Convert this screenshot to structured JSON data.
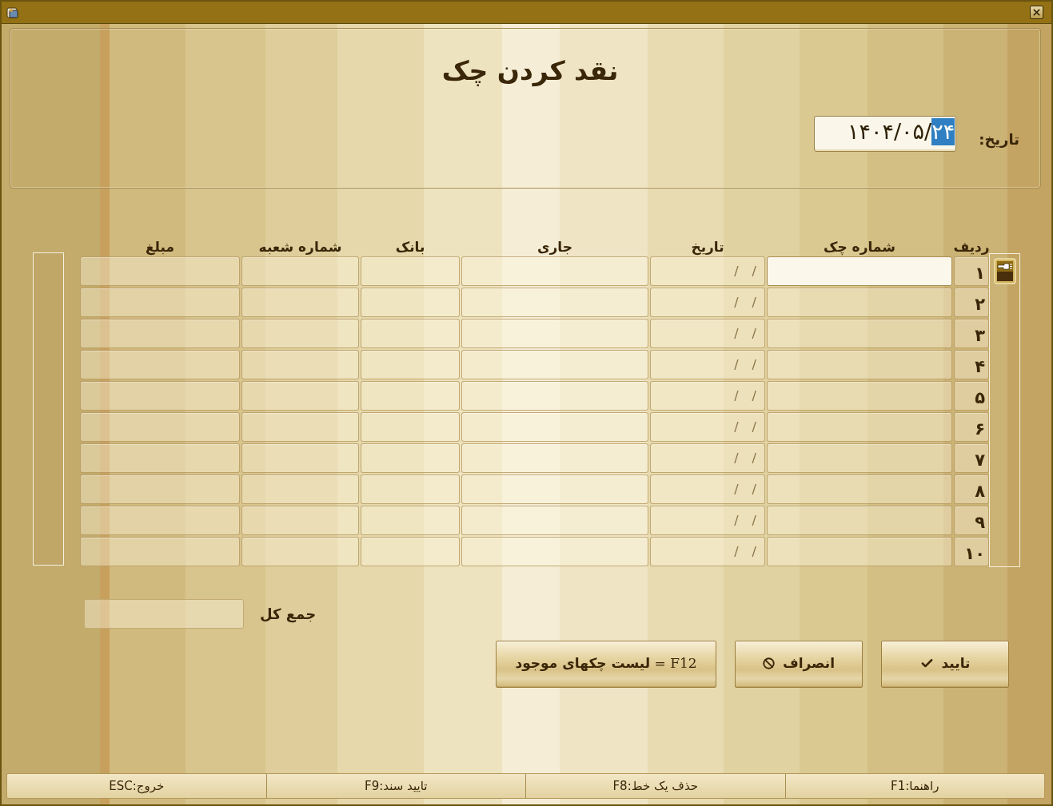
{
  "heading": "نقد کردن چک",
  "date_field": {
    "label": "تاریخ:",
    "value": "۱۴۰۴/۰۵/۲۴",
    "day_selected": true
  },
  "table": {
    "columns": [
      "ردیف",
      "شماره چک",
      "تاریخ",
      "جاری",
      "بانک",
      "شماره شعبه",
      "مبلغ"
    ],
    "rows": [
      {
        "number": "۱",
        "date": "/ /",
        "current": true
      },
      {
        "number": "۲",
        "date": "/ /",
        "current": false
      },
      {
        "number": "۳",
        "date": "/ /",
        "current": false
      },
      {
        "number": "۴",
        "date": "/ /",
        "current": false
      },
      {
        "number": "۵",
        "date": "/ /",
        "current": false
      },
      {
        "number": "۶",
        "date": "/ /",
        "current": false
      },
      {
        "number": "۷",
        "date": "/ /",
        "current": false
      },
      {
        "number": "۸",
        "date": "/ /",
        "current": false
      },
      {
        "number": "۹",
        "date": "/ /",
        "current": false
      },
      {
        "number": "۱۰",
        "date": "/ /",
        "current": false
      }
    ]
  },
  "total": {
    "label": "جمع کل"
  },
  "buttons": [
    {
      "kind": "confirm",
      "label": "تایید"
    },
    {
      "kind": "cancel",
      "label": "انصراف"
    },
    {
      "kind": "list",
      "label": "F12 = **لیست چکهای موجود**"
    }
  ],
  "status_bar": [
    "راهنما:F1",
    "حذف یک خط:F8",
    "تایید سند:F9",
    "خروج:ESC"
  ]
}
